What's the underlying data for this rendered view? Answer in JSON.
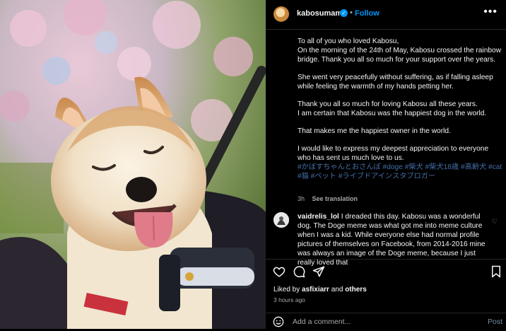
{
  "post": {
    "username": "kabosumama",
    "verified_icon": "verified-badge-icon",
    "separator": "•",
    "follow_label": "Follow",
    "more_icon": "more-options-icon"
  },
  "caption": {
    "paragraphs": [
      "To all of you who loved Kabosu,\nOn the morning of the 24th of May, Kabosu crossed the rainbow bridge. Thank you all so much for your support over the years.",
      "She went very peacefully without suffering, as if falling asleep while feeling the warmth of my hands petting her.",
      "Thank you all so much for loving Kabosu all these years.\nI am certain that Kabosu was the happiest dog in the world.",
      "That makes me the happiest owner in the world.",
      "I would like to express my deepest appreciation to everyone who has sent us much love to us."
    ],
    "hashtags": "#かぼすちゃんとおさんぽ #doge #柴犬 #柴犬18歳 #高齢犬 #cat #猫 #ペット #ライブドアインスタブロガー",
    "time": "3h",
    "see_translation": "See translation"
  },
  "comment": {
    "username": "vaidrelis_lol",
    "text": "I dreaded this day. Kabosu was a wonderful dog. The Doge meme was what got me into meme culture when I was a kid. While everyone else had normal profile pictures of themselves on Facebook, from 2014-2016 mine was always an image of the Doge meme, because I just really loved that"
  },
  "likes": {
    "prefix": "Liked by",
    "user": "asfixiarr",
    "joiner": "and",
    "others": "others",
    "time_ago": "3 hours ago"
  },
  "add_comment": {
    "placeholder": "Add a comment...",
    "post_label": "Post"
  },
  "colors": {
    "link_blue": "#0095f6",
    "hashtag_blue": "#436ea8",
    "secondary_text": "#a8a8a8",
    "background": "#000000"
  }
}
